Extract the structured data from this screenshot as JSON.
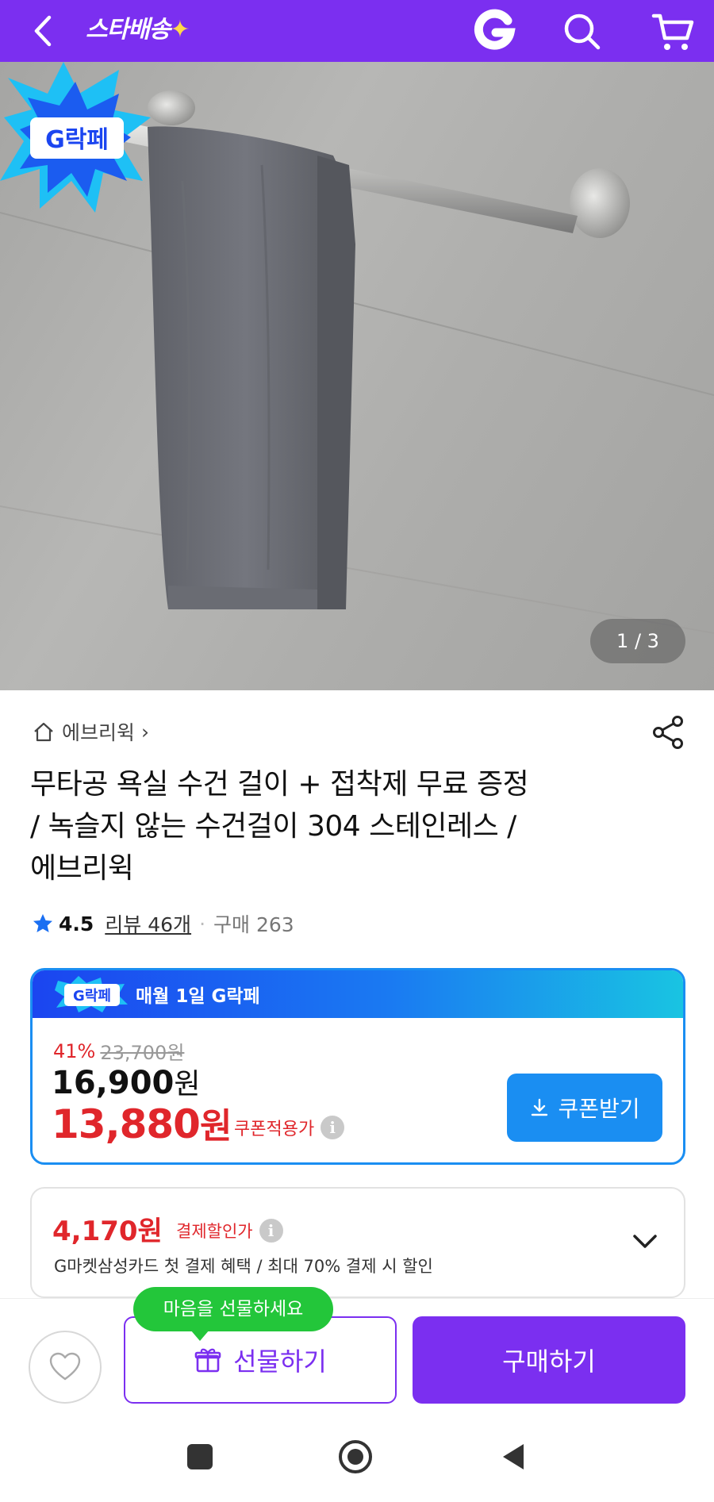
{
  "header": {
    "logo_text": "스타배송",
    "logo_spark": "✦",
    "bg_color": "#7b2ff0",
    "icons": [
      "back-icon",
      "gmarket-g-icon",
      "search-icon",
      "cart-icon"
    ]
  },
  "gallery": {
    "indicator": "1 / 3",
    "current": 1,
    "total": 3,
    "badge_text": "G락페"
  },
  "breadcrumb": {
    "label": "에브리윅",
    "chevron": "›"
  },
  "product": {
    "title_lines": [
      "무타공 욕실 수건 걸이 + 접착제 무료 증정",
      "/ 녹슬지 않는 수건걸이 304 스테인레스 /",
      "에브리윅"
    ],
    "rating": "4.5",
    "review": "리뷰 46개",
    "separator": "·",
    "purchases": "구매 263"
  },
  "coupon": {
    "badge_text": "G락페",
    "headline": "매월 1일 G락페",
    "discount_pct": "41%",
    "original_price": "23,700원",
    "sale_price": "16,900",
    "sale_unit": "원",
    "coupon_price": "13,880",
    "coupon_unit": "원",
    "coupon_label": "쿠폰적용가",
    "button_label": "쿠폰받기",
    "accent": "#1a8ef2"
  },
  "payment": {
    "price": "4,170원",
    "label": "결제할인가",
    "description": "G마켓삼성카드 첫 결제 혜택 / 최대 70% 결제 시 할인"
  },
  "actions": {
    "tooltip": "마음을 선물하세요",
    "gift_label": "선물하기",
    "buy_label": "구매하기",
    "accent": "#7b2ff0",
    "tooltip_color": "#23c63a"
  },
  "colors": {
    "sale_red": "#e0262b"
  }
}
